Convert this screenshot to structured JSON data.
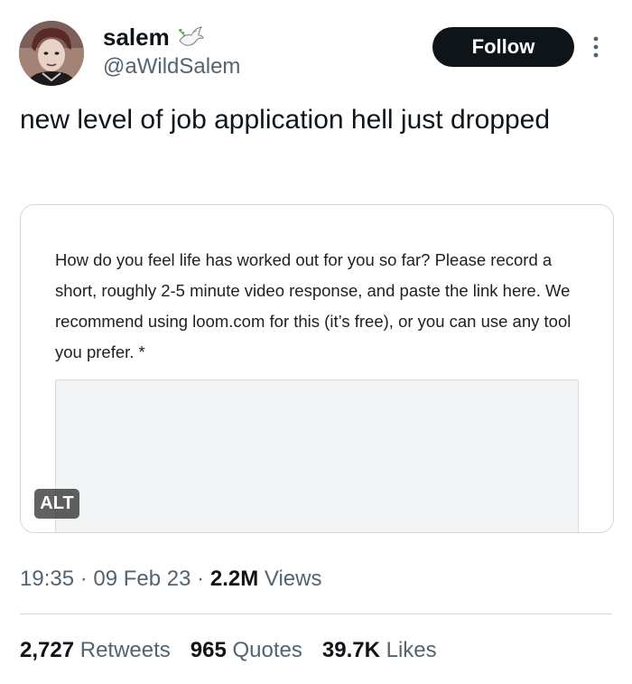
{
  "author": {
    "display_name": "salem",
    "handle": "@aWildSalem",
    "badge_icon": "dove-icon",
    "avatar_icon": "avatar-photo"
  },
  "header": {
    "follow_label": "Follow",
    "more_icon": "more-options-icon"
  },
  "tweet": {
    "text": "new level of job application hell just dropped"
  },
  "media": {
    "question_text": "How do you feel life has worked out for you so far? Please record a short, roughly 2-5 minute video response, and paste the link here. We recommend using loom.com for this (it’s free), or you can use any tool you prefer. *",
    "alt_label": "ALT"
  },
  "meta": {
    "time": "19:35",
    "separator": "·",
    "date": "09 Feb 23",
    "views_count": "2.2M",
    "views_label": "Views"
  },
  "stats": {
    "retweets_count": "2,727",
    "retweets_label": "Retweets",
    "quotes_count": "965",
    "quotes_label": "Quotes",
    "likes_count": "39.7K",
    "likes_label": "Likes"
  },
  "colors": {
    "text_primary": "#0f1419",
    "text_secondary": "#536471",
    "border": "#cfd9de",
    "follow_bg": "#0f1419"
  }
}
